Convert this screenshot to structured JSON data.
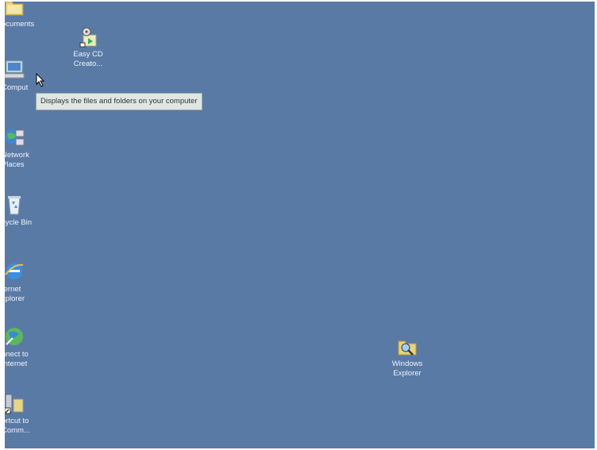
{
  "desktop": {
    "background": "#5a7aa6",
    "icons": [
      {
        "name": "my-documents",
        "label": "ocuments",
        "icon": "folder-icon"
      },
      {
        "name": "easy-cd-creator",
        "label": "Easy CD\nCreato...",
        "icon": "cd-creator-icon"
      },
      {
        "name": "my-computer",
        "label": "Comput",
        "icon": "computer-icon"
      },
      {
        "name": "network-places",
        "label": "Network\nPlaces",
        "icon": "network-icon"
      },
      {
        "name": "recycle-bin",
        "label": "cycle Bin",
        "icon": "recycle-bin-icon"
      },
      {
        "name": "internet-explorer",
        "label": "ternet\nxplorer",
        "icon": "ie-icon"
      },
      {
        "name": "connect-to-internet",
        "label": "nnect to\nInternet",
        "icon": "connect-icon"
      },
      {
        "name": "shortcut-to-comm",
        "label": "ortcut to\nComm...",
        "icon": "shortcut-icon"
      },
      {
        "name": "windows-explorer",
        "label": "Windows\nExplorer",
        "icon": "explorer-icon"
      }
    ],
    "tooltip": "Displays the files and folders on your computer"
  }
}
